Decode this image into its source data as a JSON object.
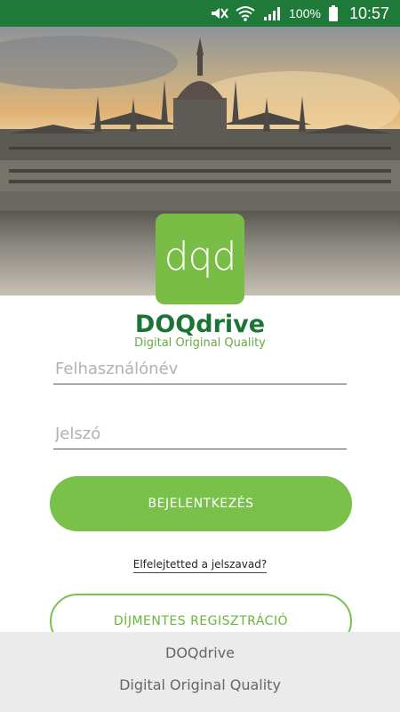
{
  "statusbar": {
    "battery_percent": "100%",
    "time": "10:57",
    "icons": [
      "mute-icon",
      "wifi-icon",
      "signal-icon",
      "battery-icon"
    ]
  },
  "logo": {
    "mark": "dqd",
    "name": "DOQdrive",
    "tagline": "Digital Original Quality"
  },
  "form": {
    "username_placeholder": "Felhasználónév",
    "username_value": "",
    "password_placeholder": "Jelszó",
    "password_value": "",
    "login_label": "BEJELENTKEZÉS",
    "forgot_label": "Elfelejtetted a jelszavad?",
    "register_label": "DÍJMENTES REGISZTRÁCIÓ"
  },
  "footer": {
    "line1": "DOQdrive",
    "line2": "Digital Original Quality"
  },
  "colors": {
    "status_bar": "#1f7a39",
    "accent_green": "#7ac14b",
    "brand_dark_green": "#1a7534"
  }
}
